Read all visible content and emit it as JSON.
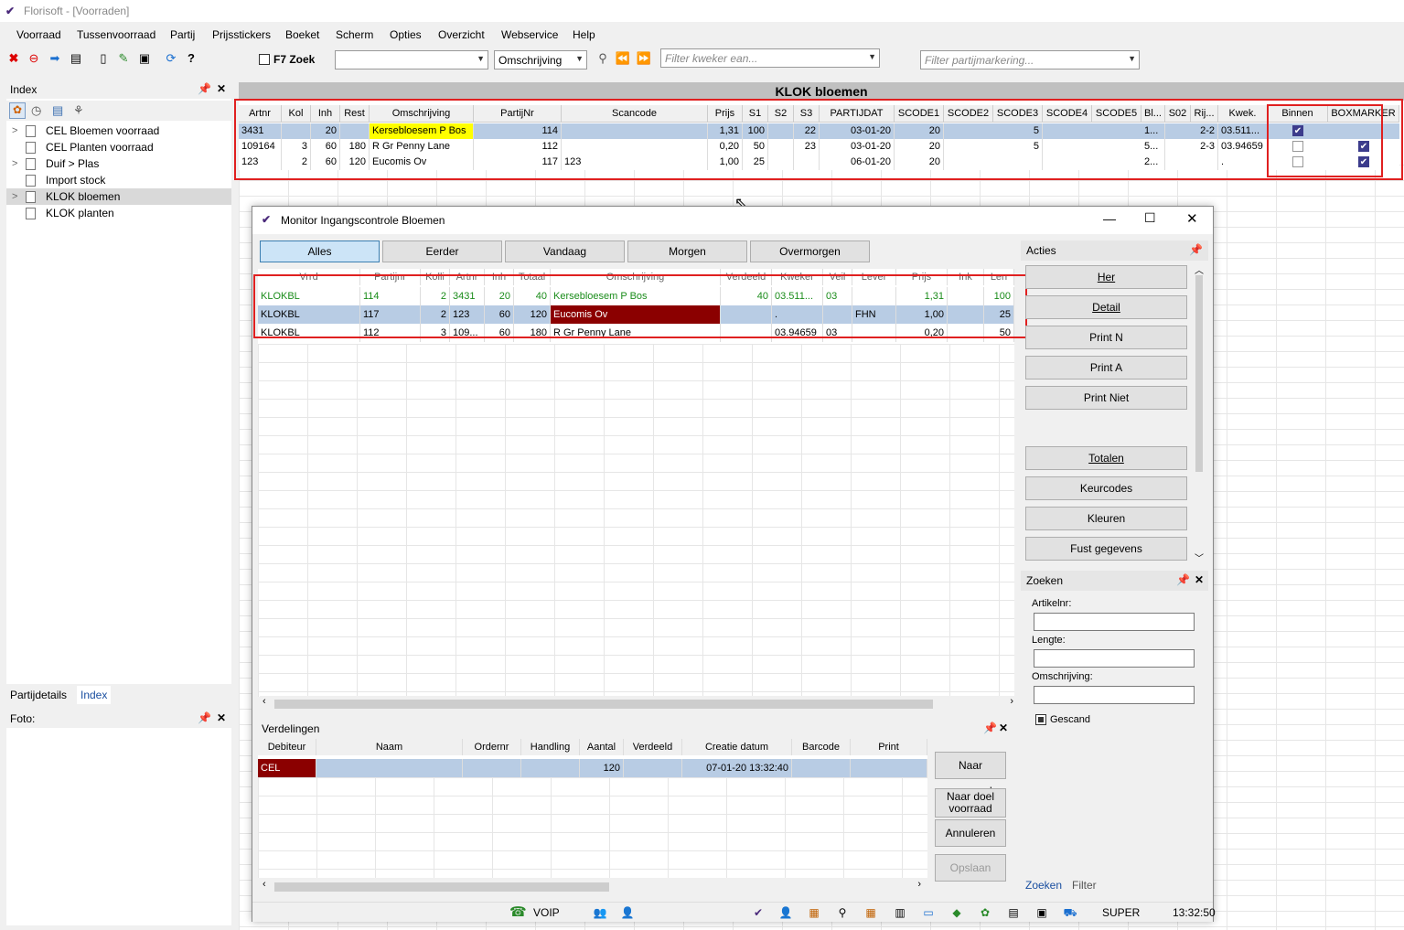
{
  "app": {
    "title": "Florisoft - [Voorraden]"
  },
  "menu": [
    "Voorraad",
    "Tussenvoorraad",
    "Partij",
    "Prijsstickers",
    "Boeket",
    "Scherm",
    "Opties",
    "Overzicht",
    "Webservice",
    "Help"
  ],
  "toolbar": {
    "f7_label": "F7 Zoek",
    "search_value": "",
    "search_field": "Omschrijving",
    "filter_kweker": "Filter kweker ean...",
    "filter_partij": "Filter partijmarkering..."
  },
  "index_panel": {
    "title": "Index",
    "items": [
      "CEL Bloemen voorraad",
      "CEL Planten voorraad",
      "Duif > Plas",
      "Import stock",
      "KLOK bloemen",
      "KLOK planten"
    ],
    "tabs": [
      "Partijdetails",
      "Index"
    ]
  },
  "foto_panel": {
    "title": "Foto:"
  },
  "main_grid": {
    "title": "KLOK bloemen",
    "headers": [
      "Artnr",
      "Kol",
      "Inh",
      "Rest",
      "Omschrijving",
      "PartijNr",
      "Scancode",
      "Prijs",
      "S1",
      "S2",
      "S3",
      "PARTIJDAT",
      "SCODE1",
      "SCODE2",
      "SCODE3",
      "SCODE4",
      "SCODE5",
      "Bl...",
      "S02",
      "Rij...",
      "Kwek.",
      "Binnen",
      "BOXMARKER"
    ],
    "rows": [
      {
        "artnr": "3431",
        "kol": "",
        "inh": "20",
        "rest": "",
        "oms": "Kersebloesem P Bos",
        "partijnr": "114",
        "scan": "",
        "prijs": "1,31",
        "s1": "100",
        "s2": "",
        "s3": "22",
        "partijdat": "03-01-20",
        "scode1": "20",
        "scode3": "5",
        "bl": "1...",
        "rij": "2-2",
        "kwek": "03.511...",
        "binnen": true,
        "boxmarker": false
      },
      {
        "artnr": "109164",
        "kol": "3",
        "inh": "60",
        "rest": "180",
        "oms": "R Gr Penny Lane",
        "partijnr": "112",
        "scan": "",
        "prijs": "0,20",
        "s1": "50",
        "s2": "",
        "s3": "23",
        "partijdat": "03-01-20",
        "scode1": "20",
        "scode3": "5",
        "bl": "5...",
        "rij": "2-3",
        "kwek": "03.94659",
        "binnen": false,
        "boxmarker": true
      },
      {
        "artnr": "123",
        "kol": "2",
        "inh": "60",
        "rest": "120",
        "oms": "Eucomis Ov",
        "partijnr": "117",
        "scan": "123",
        "prijs": "1,00",
        "s1": "25",
        "s2": "",
        "s3": "",
        "partijdat": "06-01-20",
        "scode1": "20",
        "scode3": "",
        "bl": "2...",
        "rij": "",
        "kwek": ".",
        "binnen": false,
        "boxmarker": true
      }
    ]
  },
  "monitor": {
    "title": "Monitor Ingangscontrole Bloemen",
    "filters": [
      "Alles",
      "Eerder",
      "Vandaag",
      "Morgen",
      "Overmorgen"
    ],
    "headers": [
      "Vrrd",
      "Partijnr",
      "Kolli",
      "Artnr",
      "Inh",
      "Totaal",
      "Omschrijving",
      "Verdeeld",
      "Kweker",
      "Veil",
      "Lever",
      "Prijs",
      "Ink",
      "Len"
    ],
    "rows": [
      {
        "vrrd": "KLOKBL",
        "partijnr": "114",
        "kolli": "2",
        "artnr": "3431",
        "inh": "20",
        "totaal": "40",
        "oms": "Kersebloesem P Bos",
        "verdeeld": "40",
        "kweker": "03.511...",
        "veil": "03",
        "lever": "",
        "prijs": "1,31",
        "ink": "",
        "len": "100"
      },
      {
        "vrrd": "KLOKBL",
        "partijnr": "117",
        "kolli": "2",
        "artnr": "123",
        "inh": "60",
        "totaal": "120",
        "oms": "Eucomis Ov",
        "verdeeld": "",
        "kweker": ".",
        "veil": "",
        "lever": "FHN",
        "prijs": "1,00",
        "ink": "",
        "len": "25"
      },
      {
        "vrrd": "KLOKBL",
        "partijnr": "112",
        "kolli": "3",
        "artnr": "109...",
        "inh": "60",
        "totaal": "180",
        "oms": "R Gr Penny Lane",
        "verdeeld": "",
        "kweker": "03.94659",
        "veil": "03",
        "lever": "",
        "prijs": "0,20",
        "ink": "",
        "len": "50"
      }
    ],
    "acties": {
      "title": "Acties",
      "buttons": [
        "Her",
        "Detail",
        "Print N",
        "Print A",
        "Print Niet",
        "Totalen",
        "Keurcodes",
        "Kleuren",
        "Fust gegevens"
      ]
    },
    "zoeken": {
      "title": "Zoeken",
      "artikelnr_label": "Artikelnr:",
      "lengte_label": "Lengte:",
      "omschrijving_label": "Omschrijving:",
      "gescand_label": "Gescand",
      "tabs": [
        "Zoeken",
        "Filter"
      ]
    },
    "verdelingen": {
      "title": "Verdelingen",
      "headers": [
        "Debiteur",
        "Naam",
        "Ordernr",
        "Handling",
        "Aantal",
        "Verdeeld",
        "Creatie datum",
        "Barcode",
        "Print"
      ],
      "row": {
        "debiteur": "CEL",
        "naam": "",
        "ordernr": "",
        "handling": "",
        "aantal": "120",
        "verdeeld": "",
        "creatie": "07-01-20 13:32:40",
        "barcode": "",
        "print": ""
      },
      "buttons": [
        "Naar voorraad",
        "Naar doel voorraad",
        "Annuleren",
        "Opslaan"
      ]
    },
    "status": {
      "voip": "VOIP",
      "user": "SUPER",
      "time": "13:32:50"
    }
  },
  "colors": {
    "highlight": "#ffff00",
    "darkred": "#8b0000",
    "selection": "#b8cce4",
    "green_text": "#1a8c1a",
    "redbox": "#e02020"
  }
}
